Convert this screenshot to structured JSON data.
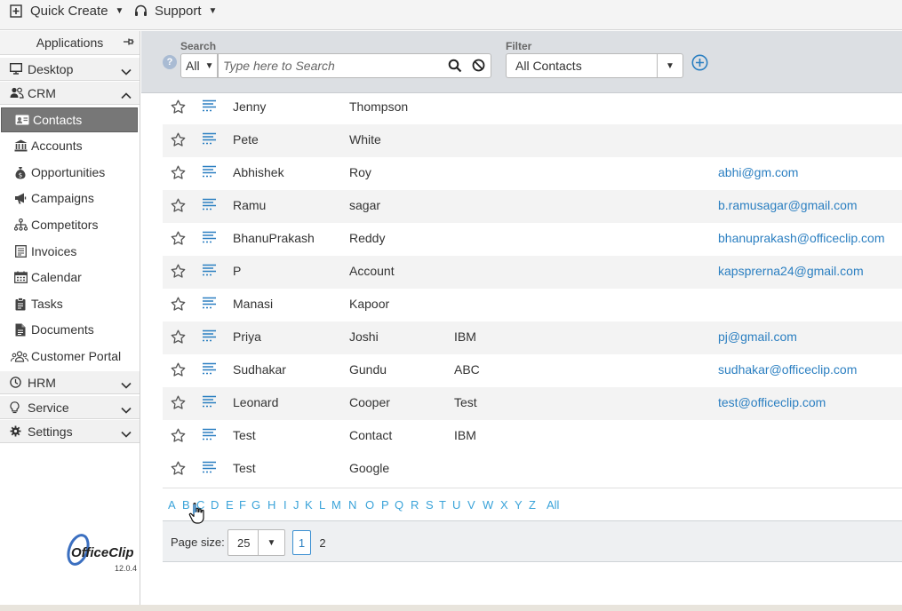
{
  "topbar": {
    "quick_create": "Quick Create",
    "support": "Support"
  },
  "sidebar": {
    "applications": "Applications",
    "groups": {
      "desktop": "Desktop",
      "crm": "CRM",
      "hrm": "HRM",
      "service": "Service",
      "settings": "Settings"
    },
    "crm_items": [
      {
        "label": "Contacts",
        "icon": "contact-card-icon",
        "active": true
      },
      {
        "label": "Accounts",
        "icon": "bank-icon"
      },
      {
        "label": "Opportunities",
        "icon": "money-bag-icon"
      },
      {
        "label": "Campaigns",
        "icon": "megaphone-icon"
      },
      {
        "label": "Competitors",
        "icon": "hierarchy-icon"
      },
      {
        "label": "Invoices",
        "icon": "invoice-icon"
      },
      {
        "label": "Calendar",
        "icon": "calendar-icon"
      },
      {
        "label": "Tasks",
        "icon": "clipboard-icon"
      },
      {
        "label": "Documents",
        "icon": "document-icon"
      },
      {
        "label": "Customer Portal",
        "icon": "users-group-icon"
      }
    ],
    "logo_text": "OfficeClip",
    "version": "12.0.4"
  },
  "search": {
    "label": "Search",
    "scope": "All",
    "placeholder": "Type here to Search",
    "value": ""
  },
  "filter": {
    "label": "Filter",
    "value": "All Contacts"
  },
  "colors": {
    "link": "#2b7fc1",
    "alpha": "#3aa3d9",
    "active_menu": "#777777",
    "panel": "#dcdfe3"
  },
  "contacts": [
    {
      "first": "Jenny",
      "last": "Thompson",
      "company": "",
      "email": ""
    },
    {
      "first": "Pete",
      "last": "White",
      "company": "",
      "email": ""
    },
    {
      "first": "Abhishek",
      "last": "Roy",
      "company": "",
      "email": "abhi@gm.com"
    },
    {
      "first": "Ramu",
      "last": "sagar",
      "company": "",
      "email": "b.ramusagar@gmail.com"
    },
    {
      "first": "BhanuPrakash",
      "last": "Reddy",
      "company": "",
      "email": "bhanuprakash@officeclip.com"
    },
    {
      "first": "P",
      "last": "Account",
      "company": "",
      "email": "kapsprerna24@gmail.com"
    },
    {
      "first": "Manasi",
      "last": "Kapoor",
      "company": "",
      "email": ""
    },
    {
      "first": "Priya",
      "last": "Joshi",
      "company": "IBM",
      "email": "pj@gmail.com"
    },
    {
      "first": "Sudhakar",
      "last": "Gundu",
      "company": "ABC",
      "email": "sudhakar@officeclip.com"
    },
    {
      "first": "Leonard",
      "last": "Cooper",
      "company": "Test",
      "email": "test@officeclip.com"
    },
    {
      "first": "Test",
      "last": "Contact",
      "company": "IBM",
      "email": ""
    },
    {
      "first": "Test",
      "last": "Google",
      "company": "",
      "email": ""
    }
  ],
  "alphabet": [
    "A",
    "B",
    "C",
    "D",
    "E",
    "F",
    "G",
    "H",
    "I",
    "J",
    "K",
    "L",
    "M",
    "N",
    "O",
    "P",
    "Q",
    "R",
    "S",
    "T",
    "U",
    "V",
    "W",
    "X",
    "Y",
    "Z",
    "All"
  ],
  "pager": {
    "page_size_label": "Page size:",
    "page_size": "25",
    "pages": [
      "1",
      "2"
    ],
    "current": "1"
  }
}
